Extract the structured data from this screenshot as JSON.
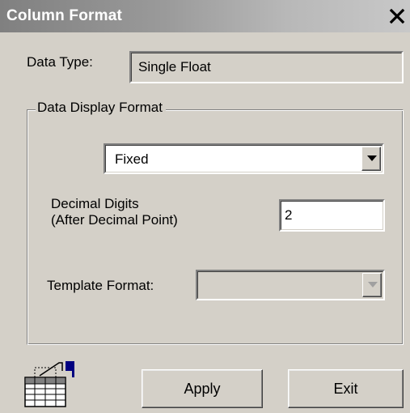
{
  "window": {
    "title": "Column Format",
    "close_glyph": "X"
  },
  "data_type": {
    "label": "Data Type:",
    "value": "Single Float"
  },
  "display_group": {
    "legend": "Data Display Format",
    "format_select": {
      "value": "Fixed"
    },
    "decimal_digits": {
      "label_line1": "Decimal Digits",
      "label_line2": "(After Decimal Point)",
      "value": "2"
    },
    "template_format": {
      "label": "Template Format:",
      "value": "",
      "disabled": true
    }
  },
  "footer": {
    "icon": "table-format-icon",
    "apply_label": "Apply",
    "exit_label": "Exit"
  },
  "colors": {
    "face": "#d4d0c8",
    "title_gradient_start": "#808080",
    "title_gradient_end": "#c8c8c8",
    "field_bg": "#ffffff"
  }
}
